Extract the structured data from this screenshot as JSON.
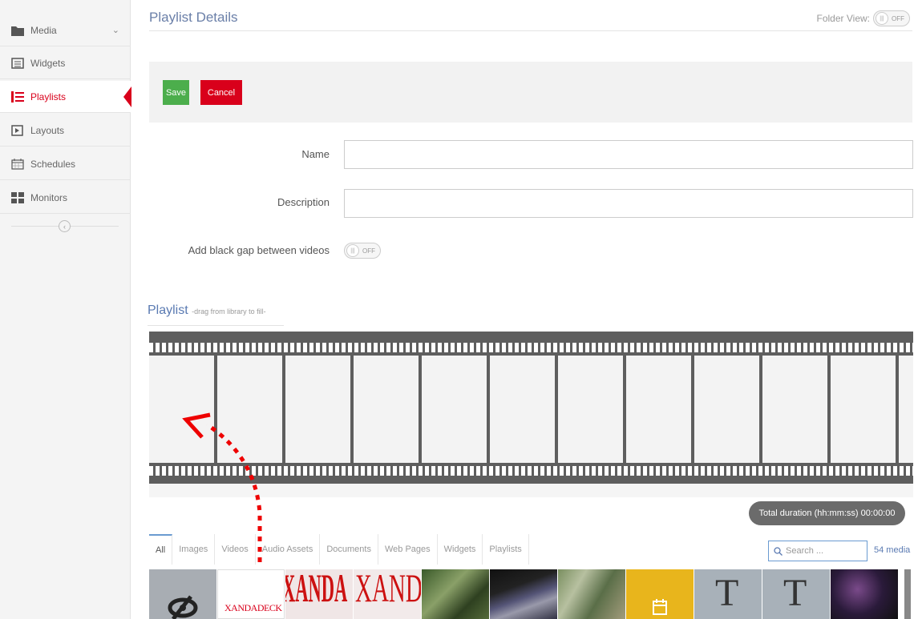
{
  "sidebar": {
    "items": [
      {
        "label": "Media",
        "icon": "folder-icon"
      },
      {
        "label": "Widgets",
        "icon": "widget-icon"
      },
      {
        "label": "Playlists",
        "icon": "list-icon"
      },
      {
        "label": "Layouts",
        "icon": "layout-icon"
      },
      {
        "label": "Schedules",
        "icon": "calendar-icon"
      },
      {
        "label": "Monitors",
        "icon": "grid-icon"
      }
    ],
    "active": "Playlists",
    "collapse_glyph": "‹"
  },
  "header": {
    "title": "Playlist Details",
    "folder_view_label": "Folder View:",
    "folder_view_state": "OFF"
  },
  "actions": {
    "save_label": "Save",
    "cancel_label": "Cancel"
  },
  "form": {
    "name_label": "Name",
    "name_value": "",
    "description_label": "Description",
    "description_value": "",
    "black_gap_label": "Add black gap between videos",
    "black_gap_state": "OFF"
  },
  "playlist": {
    "heading": "Playlist",
    "hint": "-drag from library to fill-"
  },
  "duration": {
    "text": "Total duration (hh:mm:ss) 00:00:00"
  },
  "media_tabs": [
    "All",
    "Images",
    "Videos",
    "Audio Assets",
    "Documents",
    "Web Pages",
    "Widgets",
    "Playlists"
  ],
  "search": {
    "placeholder": "Search ..."
  },
  "media_count": "54 media",
  "thumbnail_text": {
    "logo": "XANDADECK",
    "xanda": "XANDA",
    "text_glyph": "T"
  },
  "colors": {
    "accent_red": "#d9001b",
    "save_green": "#4cae4c",
    "title_blue": "#6a7fa8"
  }
}
